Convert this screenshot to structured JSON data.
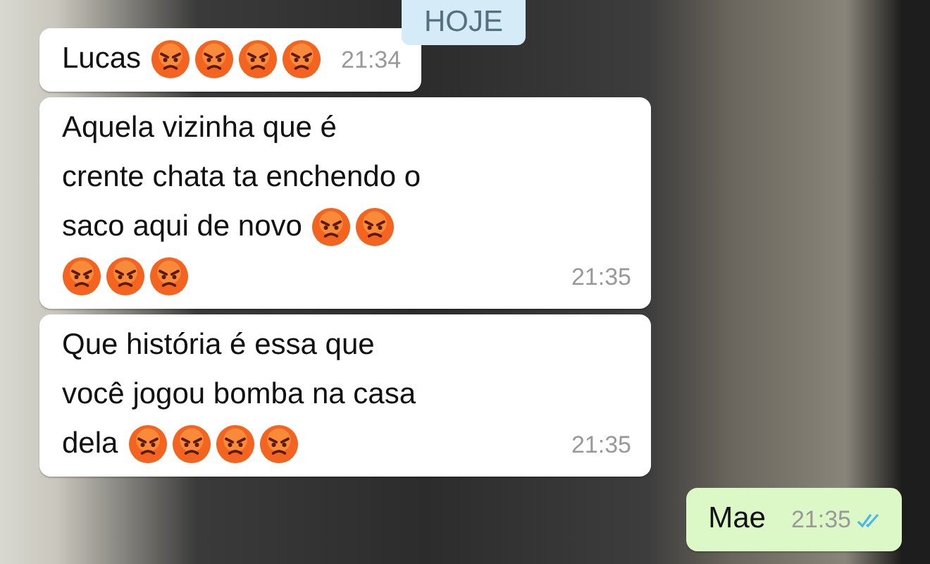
{
  "date_badge": {
    "label": "HOJE"
  },
  "messages": [
    {
      "kind": "incoming",
      "lines": [
        {
          "text": "Lucas",
          "emojis": [
            {
              "kind": "angry"
            },
            {
              "kind": "angry"
            },
            {
              "kind": "angry"
            },
            {
              "kind": "angry"
            }
          ]
        }
      ],
      "time": "21:34"
    },
    {
      "kind": "incoming",
      "lines": [
        {
          "text": "Aquela vizinha que é"
        },
        {
          "text": "crente chata ta enchendo o"
        },
        {
          "text": "saco aqui de novo",
          "emojis": [
            {
              "kind": "angry"
            },
            {
              "kind": "angry"
            }
          ]
        },
        {
          "emojis": [
            {
              "kind": "angry"
            },
            {
              "kind": "angry"
            },
            {
              "kind": "angry"
            }
          ]
        }
      ],
      "time": "21:35"
    },
    {
      "kind": "incoming",
      "lines": [
        {
          "text": "Que história é essa que"
        },
        {
          "text": "você jogou bomba na casa"
        },
        {
          "text": "dela",
          "emojis": [
            {
              "kind": "angry"
            },
            {
              "kind": "angry"
            },
            {
              "kind": "angry"
            },
            {
              "kind": "angry"
            }
          ]
        }
      ],
      "time": "21:35"
    },
    {
      "kind": "outgoing",
      "lines": [
        {
          "text": "Mae"
        }
      ],
      "time": "21:35",
      "read": true
    }
  ]
}
